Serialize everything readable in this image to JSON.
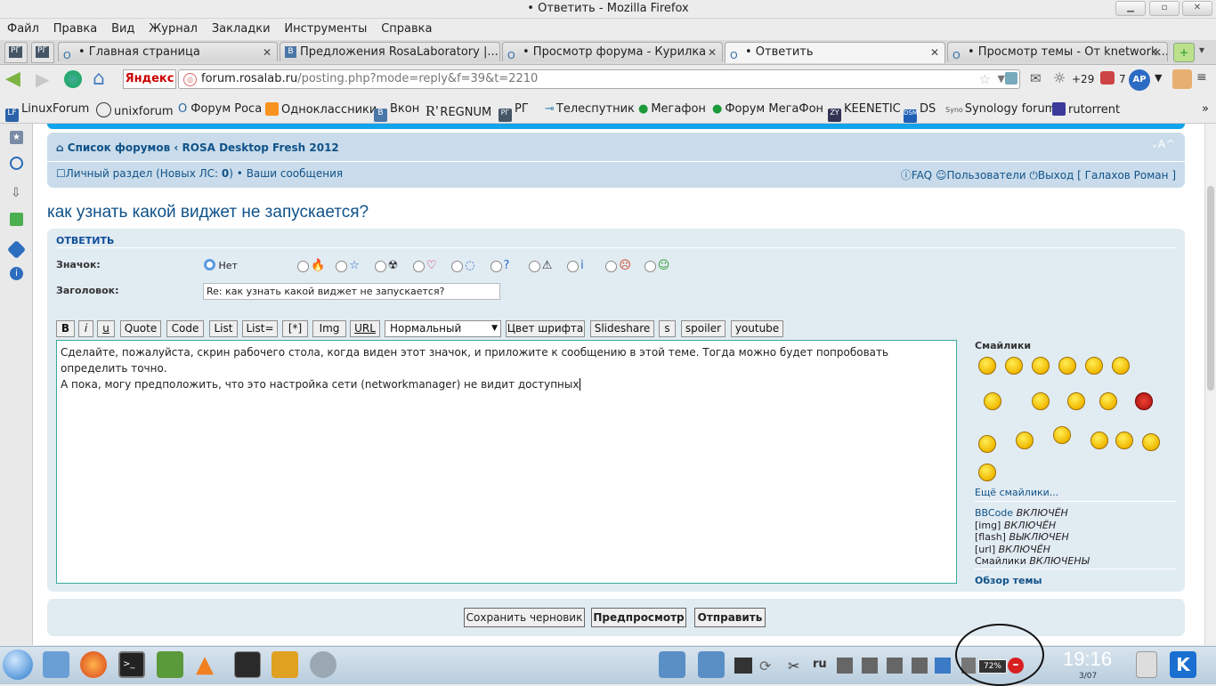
{
  "window": {
    "title": "• Ответить - Mozilla Firefox"
  },
  "menu": [
    "Файл",
    "Правка",
    "Вид",
    "Журнал",
    "Закладки",
    "Инструменты",
    "Справка"
  ],
  "tabs": [
    {
      "label": "• Главная страница"
    },
    {
      "label": "Предложения RosaLaboratory |..."
    },
    {
      "label": "• Просмотр форума - Курилка"
    },
    {
      "label": "• Ответить"
    },
    {
      "label": "• Просмотр темы - От knetwork..."
    }
  ],
  "nav": {
    "yandex_label": "Яндекс",
    "url_host": "forum.rosalab.ru",
    "url_path": "/posting.php?mode=reply&f=39&t=2210",
    "weather": "+29",
    "counter": "7"
  },
  "bookmarks": [
    "LinuxForum",
    "unixforum",
    "Форум Роса",
    "Одноклассники",
    "Вкон",
    "REGNUM",
    "РГ",
    "Телеспутник",
    "Мегафон",
    "Форум МегаФон",
    "KEENETIC",
    "DS",
    "Synology forum",
    "rutorrent"
  ],
  "breadcrumb": {
    "home": "Список форумов",
    "sep": "‹",
    "forum": "ROSA Desktop Fresh 2012"
  },
  "fontsize_ctrl": "ᵥA^",
  "userbar": {
    "private_prefix": "Личный раздел (Новых ЛС: ",
    "private_count": "0",
    "private_suffix": ")",
    "bullet": "•",
    "my_posts": "Ваши сообщения",
    "faq": "FAQ",
    "users": "Пользователи",
    "logout": "Выход [ Галахов Роман ]"
  },
  "topic_title": "как узнать какой виджет не запускается?",
  "form": {
    "header": "ОТВЕТИТЬ",
    "icon_label": "Значок:",
    "icon_none": "Нет",
    "subject_label": "Заголовок:",
    "subject_value": "Re: как узнать какой виджет не запускается?",
    "font_size_value": "Нормальный",
    "buttons": [
      "B",
      "i",
      "u",
      "Quote",
      "Code",
      "List",
      "List=",
      "[*]",
      "Img",
      "URL"
    ],
    "buttons2": [
      "Цвет шрифта",
      "Slideshare",
      "s",
      "spoiler",
      "youtube"
    ],
    "message_line1": "Сделайте, пожалуйста, скрин рабочего стола, когда виден этот значок, и приложите к сообщению в этой теме. Тогда можно будет попробовать определить точно.",
    "message_line2": "А пока, могу предположить, что это настройка сети (networkmanager) не видит доступных"
  },
  "smilies": {
    "title": "Смайлики",
    "more": "Ещё смайлики...",
    "status": [
      {
        "name": "BBCode",
        "state": "ВКЛЮЧЁН"
      },
      {
        "name": "[img]",
        "state": "ВКЛЮЧЁН"
      },
      {
        "name": "[flash]",
        "state": "ВЫКЛЮЧЕН"
      },
      {
        "name": "[url]",
        "state": "ВКЛЮЧЁН"
      },
      {
        "name": "Смайлики",
        "state": "ВКЛЮЧЕНЫ"
      }
    ],
    "review": "Обзор темы"
  },
  "actions": {
    "save_draft": "Сохранить черновик",
    "preview": "Предпросмотр",
    "submit": "Отправить"
  },
  "taskbar": {
    "lang": "ru",
    "battery": "72%",
    "clock": "19:16",
    "date": "3/07"
  }
}
